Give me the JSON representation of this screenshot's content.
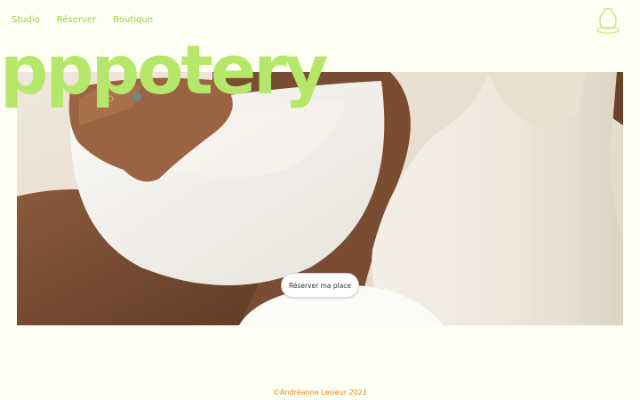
{
  "nav": {
    "items": [
      {
        "label": "Studio"
      },
      {
        "label": "Réserver"
      },
      {
        "label": "Boutique"
      }
    ]
  },
  "brand": {
    "name": "pppotery"
  },
  "hero": {
    "cta_label": "Réserver ma place"
  },
  "footer": {
    "text": "©Andréanne Lesieur 2021"
  },
  "icons": {
    "logo": "vase-icon"
  },
  "colors": {
    "background": "#fefef3",
    "accent_green": "#8fd83a",
    "brand_green": "#b5e86a",
    "footer_orange": "#e8862a"
  }
}
